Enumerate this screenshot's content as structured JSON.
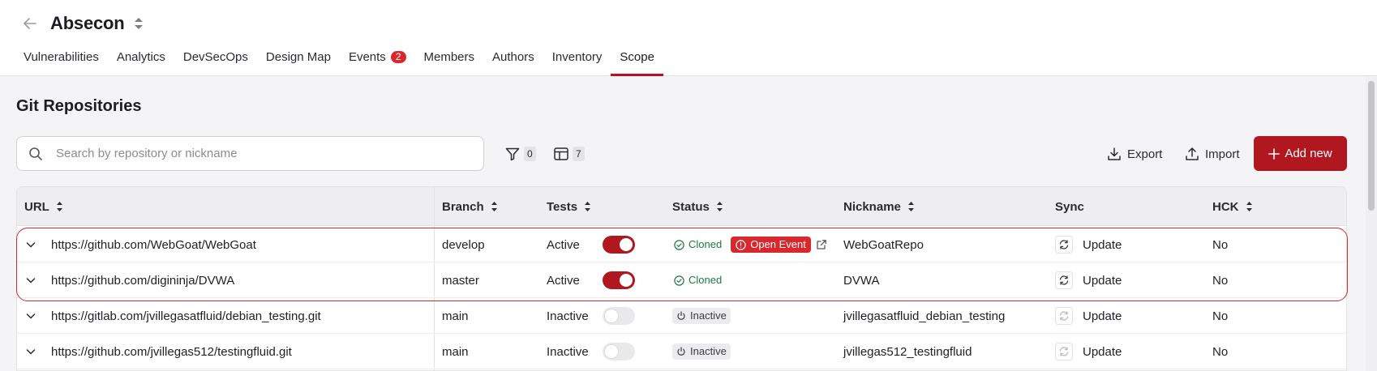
{
  "header": {
    "title": "Absecon",
    "tabs": [
      {
        "label": "Vulnerabilities"
      },
      {
        "label": "Analytics"
      },
      {
        "label": "DevSecOps"
      },
      {
        "label": "Design Map"
      },
      {
        "label": "Events",
        "badge": "2"
      },
      {
        "label": "Members"
      },
      {
        "label": "Authors"
      },
      {
        "label": "Inventory"
      },
      {
        "label": "Scope",
        "active": true
      }
    ]
  },
  "section": {
    "title": "Git Repositories",
    "search_placeholder": "Search by repository or nickname",
    "filter_count": "0",
    "columns_count": "7",
    "export_label": "Export",
    "import_label": "Import",
    "add_label": "Add new"
  },
  "table": {
    "columns": [
      "URL",
      "Branch",
      "Tests",
      "Status",
      "Nickname",
      "Sync",
      "HCK"
    ],
    "rows": [
      {
        "url": "https://github.com/WebGoat/WebGoat",
        "branch": "develop",
        "tests": "Active",
        "tests_on": true,
        "status": "Cloned",
        "event": "Open Event",
        "nickname": "WebGoatRepo",
        "sync": "Update",
        "hck": "No"
      },
      {
        "url": "https://github.com/digininja/DVWA",
        "branch": "master",
        "tests": "Active",
        "tests_on": true,
        "status": "Cloned",
        "nickname": "DVWA",
        "sync": "Update",
        "hck": "No"
      },
      {
        "url": "https://gitlab.com/jvillegasatfluid/debian_testing.git",
        "branch": "main",
        "tests": "Inactive",
        "tests_on": false,
        "status": "Inactive",
        "nickname": "jvillegasatfluid_debian_testing",
        "sync": "Update",
        "hck": "No"
      },
      {
        "url": "https://github.com/jvillegas512/testingfluid.git",
        "branch": "main",
        "tests": "Inactive",
        "tests_on": false,
        "status": "Inactive",
        "nickname": "jvillegas512_testingfluid",
        "sync": "Update",
        "hck": "No"
      }
    ]
  },
  "colors": {
    "accent": "#b0171f",
    "badge_red": "#d9272e",
    "cloned_green": "#1c7a3a"
  },
  "icons": {
    "back": "arrow-left-icon",
    "title_sort": "sort-icon",
    "search": "search-icon",
    "filter": "filter-icon",
    "columns": "columns-icon",
    "export": "download-icon",
    "import": "upload-icon",
    "add": "plus-icon",
    "row_expand": "chevron-down-icon",
    "status_cloned": "check-circle-icon",
    "status_inactive": "power-icon",
    "event": "alert-circle-icon",
    "external": "external-link-icon",
    "sync": "refresh-icon"
  }
}
